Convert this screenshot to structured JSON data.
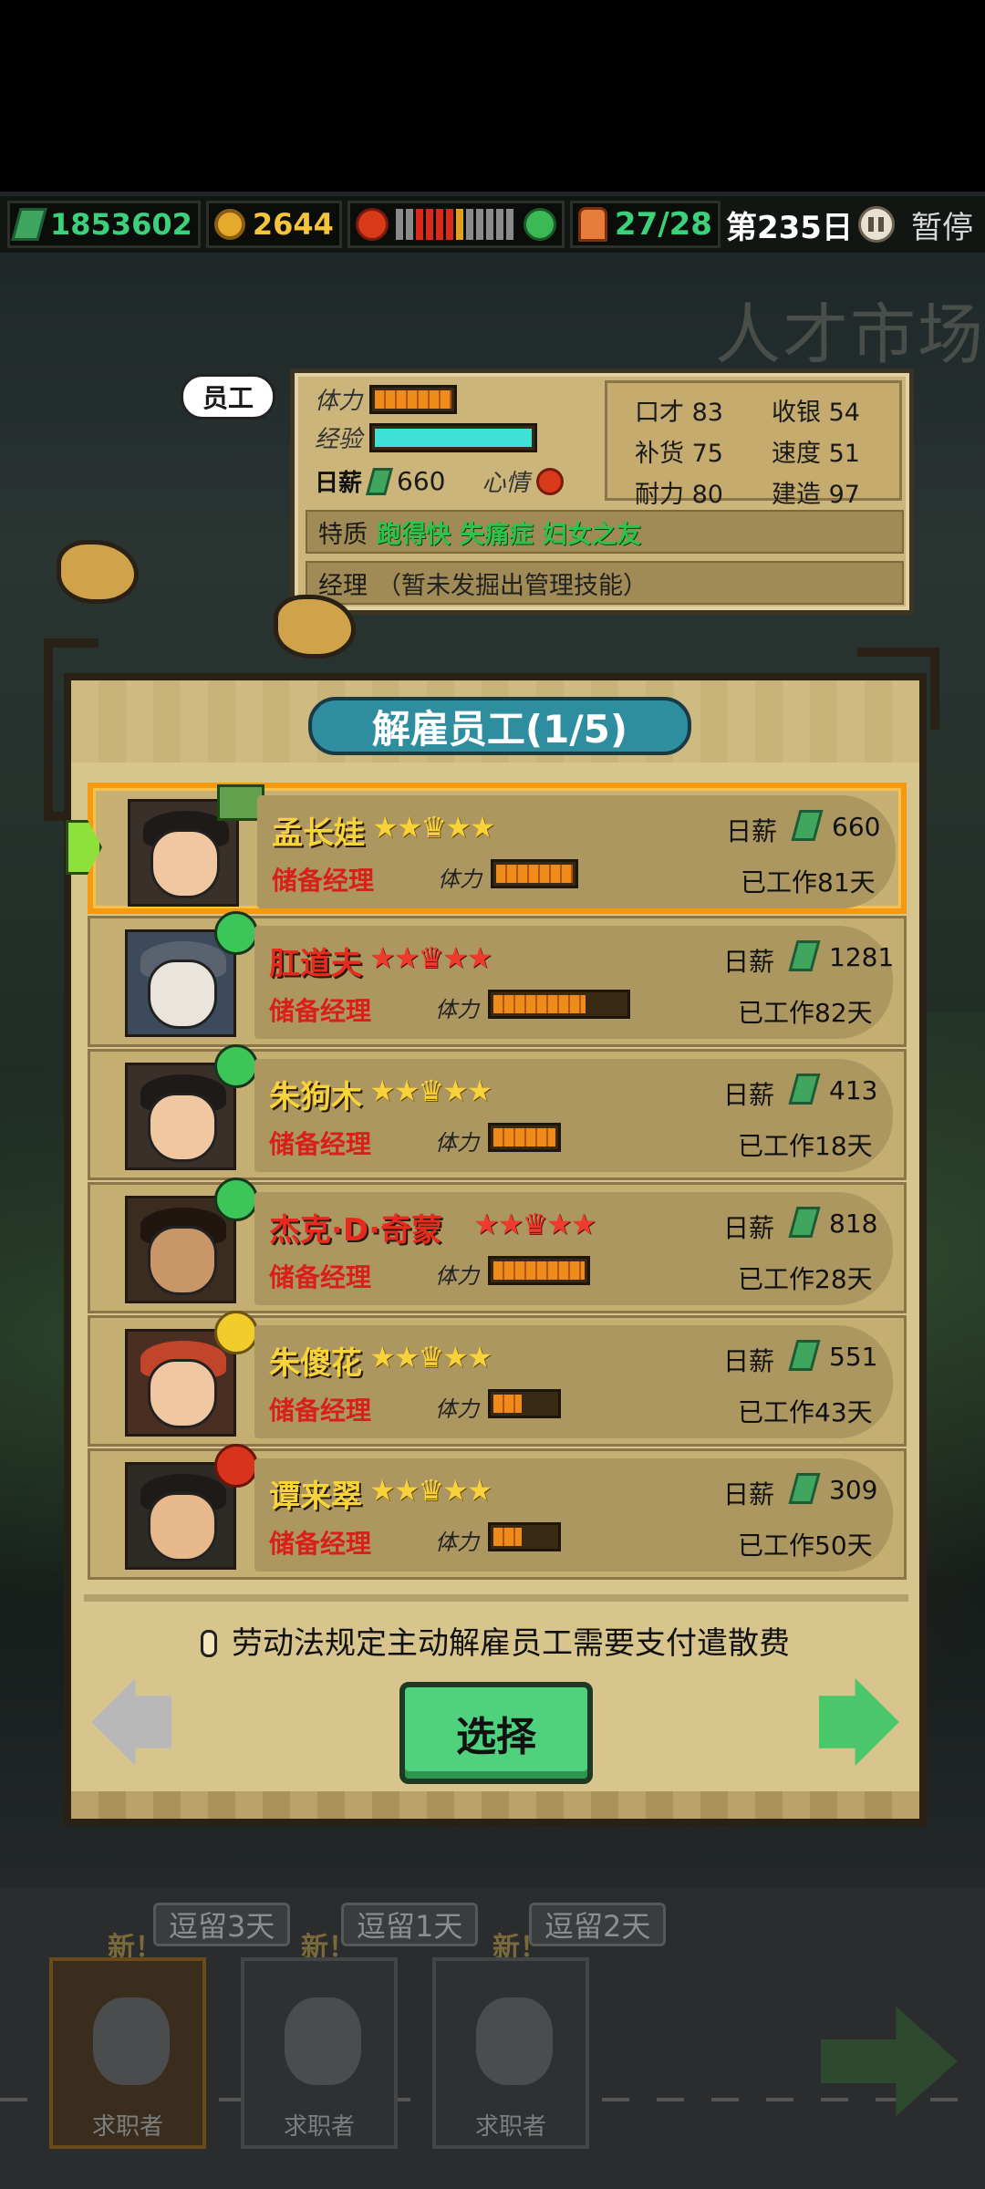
{
  "topbar": {
    "money": "1853602",
    "coins": "2644",
    "staff": "27/28",
    "day": "第235日",
    "pause": "暂停"
  },
  "market_title": "人才市场",
  "selected_employee": {
    "tag": "员工",
    "stamina_label": "体力",
    "experience_label": "经验",
    "wage_label": "日薪",
    "wage": "660",
    "mood_label": "心情",
    "attributes": [
      {
        "label": "口才",
        "value": "83"
      },
      {
        "label": "收银",
        "value": "54"
      },
      {
        "label": "补货",
        "value": "75"
      },
      {
        "label": "速度",
        "value": "51"
      },
      {
        "label": "耐力",
        "value": "80"
      },
      {
        "label": "建造",
        "value": "97"
      }
    ],
    "traits_label": "特质",
    "traits": [
      "跑得快",
      "失痛症",
      "妇女之友"
    ],
    "manager_label": "经理",
    "manager_text": "（暂未发掘出管理技能）"
  },
  "panel": {
    "title": "解雇员工(1/5)",
    "law_note": "劳动法规定主动解雇员工需要支付遣散费",
    "select_button": "选择"
  },
  "employees": [
    {
      "name": "孟长娃",
      "stars": "★★♛★★",
      "role": "储备经理",
      "stamina_label": "体力",
      "wage_label": "日薪",
      "wage": "660",
      "days": "已工作81天"
    },
    {
      "name": "肛道夫",
      "stars": "★★♛★★",
      "role": "储备经理",
      "stamina_label": "体力",
      "wage_label": "日薪",
      "wage": "1281",
      "days": "已工作82天"
    },
    {
      "name": "朱狗木",
      "stars": "★★♛★★",
      "role": "储备经理",
      "stamina_label": "体力",
      "wage_label": "日薪",
      "wage": "413",
      "days": "已工作18天"
    },
    {
      "name": "杰克·D·奇蒙",
      "stars": "★★♛★★",
      "role": "储备经理",
      "stamina_label": "体力",
      "wage_label": "日薪",
      "wage": "818",
      "days": "已工作28天"
    },
    {
      "name": "朱傻花",
      "stars": "★★♛★★",
      "role": "储备经理",
      "stamina_label": "体力",
      "wage_label": "日薪",
      "wage": "551",
      "days": "已工作43天"
    },
    {
      "name": "谭来翠",
      "stars": "★★♛★★",
      "role": "储备经理",
      "stamina_label": "体力",
      "wage_label": "日薪",
      "wage": "309",
      "days": "已工作50天"
    }
  ],
  "candidates": {
    "stays": [
      "逗留3天",
      "逗留1天",
      "逗留2天"
    ],
    "new_label": "新！",
    "label": "求职者"
  }
}
